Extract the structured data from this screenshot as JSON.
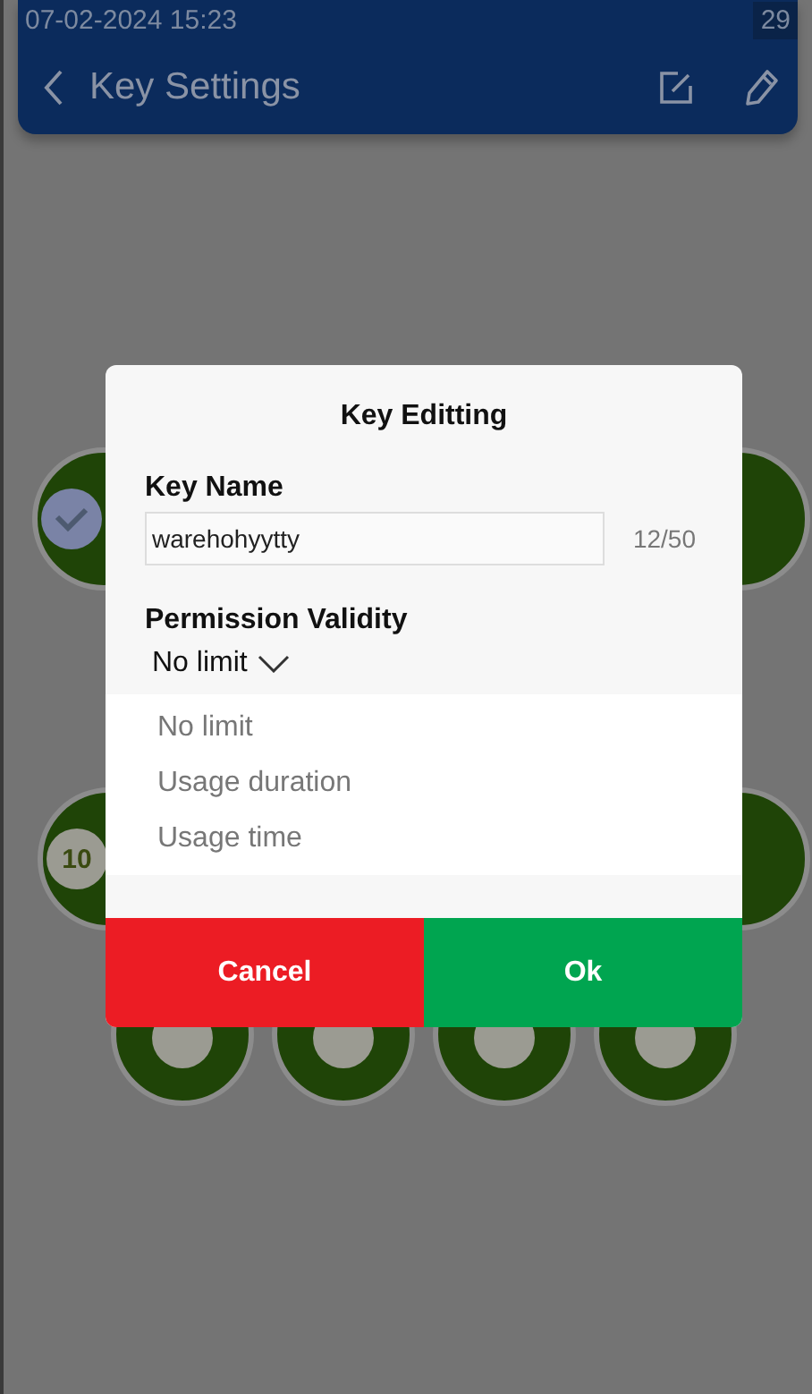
{
  "status_bar": {
    "time": "07-02-2024 15:23",
    "battery": "29"
  },
  "header": {
    "title": "Key Settings"
  },
  "keys": [
    {
      "kind": "check"
    },
    {
      "kind": "plain"
    },
    {
      "kind": "number",
      "number": "10"
    },
    {
      "kind": "plain"
    },
    {
      "kind": "badge"
    },
    {
      "kind": "badge"
    },
    {
      "kind": "badge"
    },
    {
      "kind": "badge"
    }
  ],
  "dialog": {
    "title": "Key Editting",
    "name_label": "Key Name",
    "name_value": "warehohyytty",
    "counter": "12/50",
    "validity_label": "Permission Validity",
    "validity_value": "No limit",
    "options": [
      "No limit",
      "Usage duration",
      "Usage time"
    ],
    "buttons": [
      {
        "kind": "cancel",
        "label": "Cancel"
      },
      {
        "kind": "ok",
        "label": "Ok"
      }
    ]
  }
}
